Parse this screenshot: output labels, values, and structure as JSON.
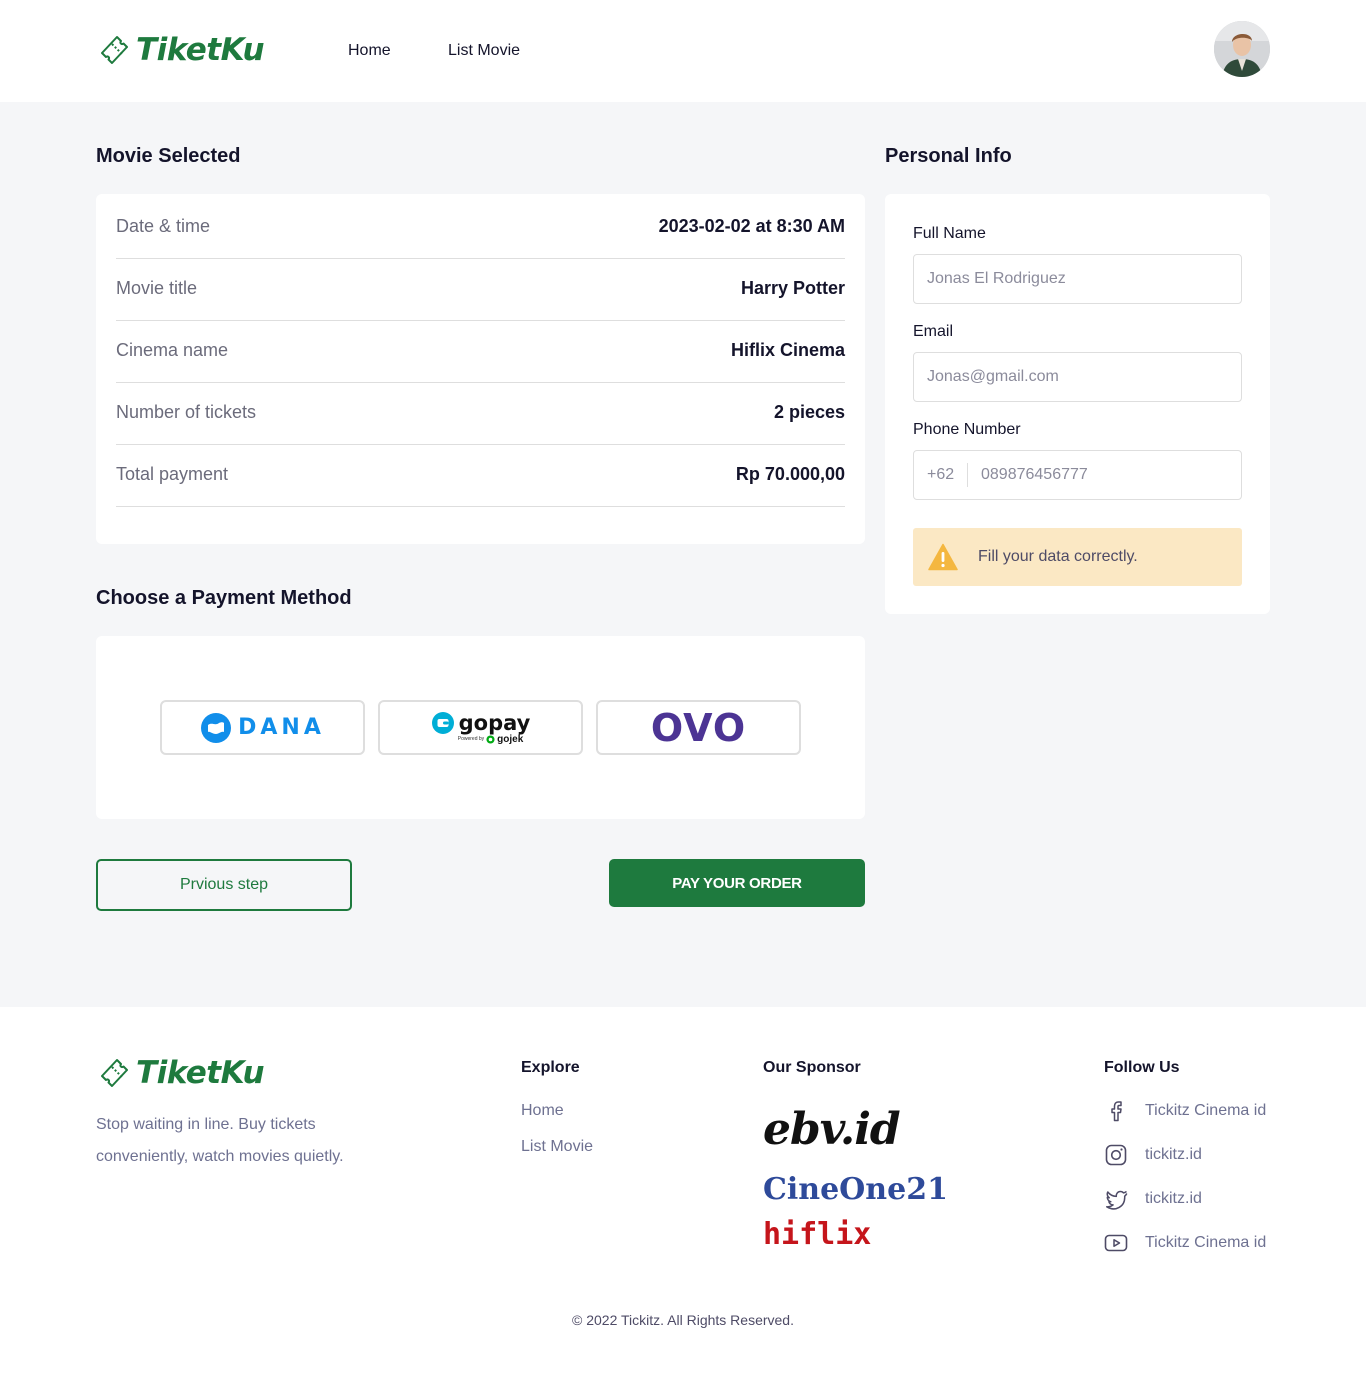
{
  "brand": {
    "name": "TiketKu",
    "color": "#1e7a3e"
  },
  "nav": {
    "items": [
      "Home",
      "List Movie"
    ]
  },
  "movie_selected": {
    "title": "Movie Selected",
    "rows": [
      {
        "label": "Date & time",
        "value": "2023-02-02 at 8:30 AM"
      },
      {
        "label": "Movie title",
        "value": "Harry Potter"
      },
      {
        "label": "Cinema name",
        "value": "Hiflix Cinema"
      },
      {
        "label": "Number of tickets",
        "value": "2 pieces"
      },
      {
        "label": "Total payment",
        "value": "Rp 70.000,00"
      }
    ]
  },
  "payment": {
    "title": "Choose a Payment Method",
    "methods": [
      {
        "name": "DANA",
        "color": "#118eea"
      },
      {
        "name": "gopay",
        "powered": "Powered by",
        "powered_brand": "gojek",
        "color": "#00aed6"
      },
      {
        "name": "OVO",
        "color": "#4c3494"
      }
    ]
  },
  "actions": {
    "prev_label": "Prvious step",
    "pay_label": "PAY YOUR ORDER"
  },
  "personal_info": {
    "title": "Personal Info",
    "full_name": {
      "label": "Full Name",
      "placeholder": "Jonas El Rodriguez"
    },
    "email": {
      "label": "Email",
      "placeholder": "Jonas@gmail.com"
    },
    "phone": {
      "label": "Phone Number",
      "prefix": "+62",
      "placeholder": "089876456777"
    },
    "alert": {
      "text": "Fill your data correctly.",
      "icon": "warning-icon",
      "color": "#f4b740"
    }
  },
  "footer": {
    "tagline": "Stop waiting in line. Buy tickets conveniently, watch movies quietly.",
    "explore": {
      "heading": "Explore",
      "links": [
        "Home",
        "List Movie"
      ]
    },
    "sponsor": {
      "heading": "Our Sponsor",
      "names": [
        "ebv.id",
        "CineOne21",
        "hiflix"
      ]
    },
    "follow": {
      "heading": "Follow Us",
      "items": [
        {
          "icon": "facebook-icon",
          "label": "Tickitz Cinema id"
        },
        {
          "icon": "instagram-icon",
          "label": "tickitz.id"
        },
        {
          "icon": "twitter-icon",
          "label": "tickitz.id"
        },
        {
          "icon": "youtube-icon",
          "label": "Tickitz Cinema id"
        }
      ]
    },
    "copyright": "© 2022 Tickitz. All Rights Reserved."
  }
}
